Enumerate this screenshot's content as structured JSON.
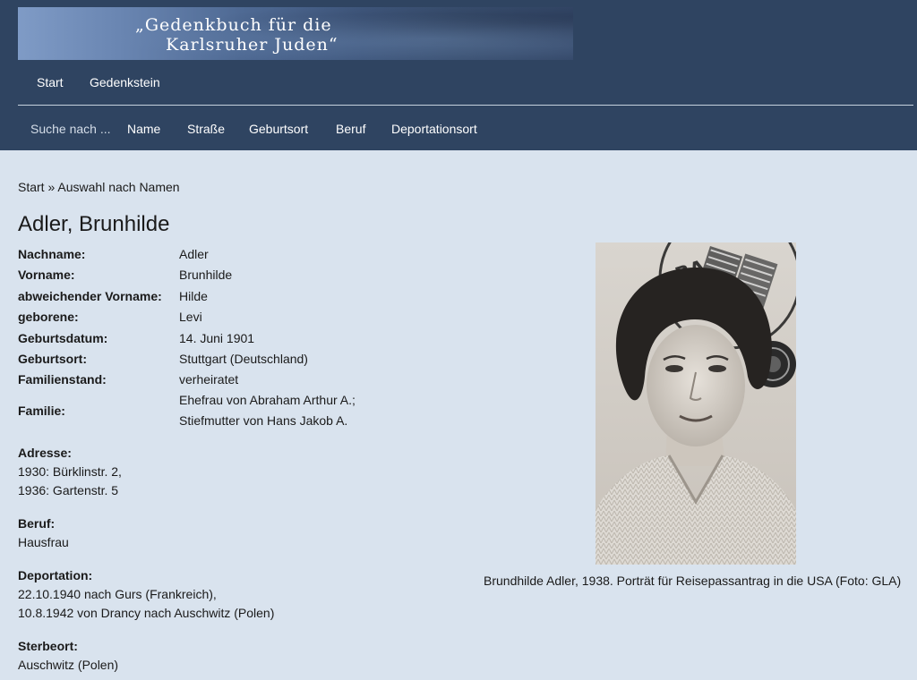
{
  "banner": {
    "line1": "„Gedenkbuch für die",
    "line2": "Karlsruher Juden“"
  },
  "topnav": [
    "Start",
    "Gedenkstein"
  ],
  "subnav": {
    "lead": "Suche nach ...",
    "items": [
      "Name",
      "Straße",
      "Geburtsort",
      "Beruf",
      "Deportationsort"
    ]
  },
  "breadcrumb": {
    "start": "Start",
    "separator": "»",
    "current": "Auswahl nach Namen"
  },
  "page_title": "Adler, Brunhilde",
  "facts": [
    {
      "key": "Nachname:",
      "value": "Adler"
    },
    {
      "key": "Vorname:",
      "value": "Brunhilde"
    },
    {
      "key": "abweichender Vorname:",
      "value": "Hilde"
    },
    {
      "key": "geborene:",
      "value": "Levi"
    },
    {
      "key": "Geburtsdatum:",
      "value": "14. Juni 1901"
    },
    {
      "key": "Geburtsort:",
      "value": "Stuttgart (Deutschland)"
    },
    {
      "key": "Familienstand:",
      "value": "verheiratet"
    },
    {
      "key": "Familie:",
      "value": "Ehefrau von Abraham Arthur A.;",
      "value2": "Stiefmutter von Hans Jakob A."
    }
  ],
  "sections": [
    {
      "heading": "Adresse:",
      "lines": [
        "1930: Bürklinstr. 2,",
        "1936: Gartenstr. 5"
      ]
    },
    {
      "heading": "Beruf:",
      "lines": [
        "Hausfrau"
      ]
    },
    {
      "heading": "Deportation:",
      "lines": [
        "22.10.1940 nach Gurs (Frankreich),",
        "10.8.1942 von Drancy nach Auschwitz (Polen)"
      ]
    },
    {
      "heading": "Sterbeort:",
      "lines": [
        "Auschwitz (Polen)"
      ]
    }
  ],
  "photo": {
    "caption": "Brundhilde Adler, 1938. Porträt für Reisepassantrag in die USA (Foto: GLA)"
  }
}
